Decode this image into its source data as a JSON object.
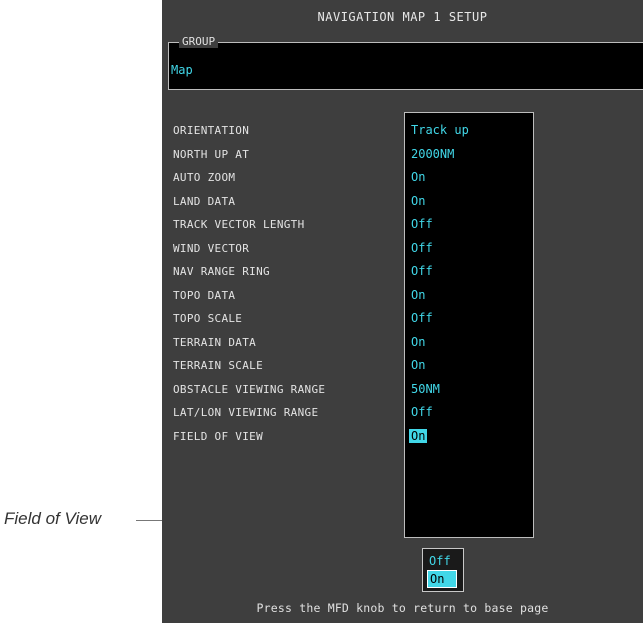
{
  "callout": {
    "text": "Field of View"
  },
  "screen": {
    "title": "NAVIGATION MAP 1 SETUP",
    "group": {
      "label": "GROUP",
      "value": "Map"
    },
    "rows": [
      {
        "label": "ORIENTATION",
        "value": "Track up"
      },
      {
        "label": "NORTH UP AT",
        "value": "2000NM"
      },
      {
        "label": "AUTO ZOOM",
        "value": "On"
      },
      {
        "label": "LAND DATA",
        "value": "On"
      },
      {
        "label": "TRACK VECTOR LENGTH",
        "value": "Off"
      },
      {
        "label": "WIND VECTOR",
        "value": "Off"
      },
      {
        "label": "NAV RANGE RING",
        "value": "Off"
      },
      {
        "label": "TOPO DATA",
        "value": "On"
      },
      {
        "label": "TOPO SCALE",
        "value": "Off"
      },
      {
        "label": "TERRAIN DATA",
        "value": "On"
      },
      {
        "label": "TERRAIN SCALE",
        "value": "On"
      },
      {
        "label": "OBSTACLE VIEWING RANGE",
        "value": "50NM"
      },
      {
        "label": "LAT/LON VIEWING RANGE",
        "value": "Off"
      },
      {
        "label": "FIELD OF VIEW",
        "value": "On"
      }
    ],
    "popup": {
      "options": [
        "Off",
        "On"
      ],
      "selected": "On"
    },
    "footer": "Press the MFD knob to return to base page"
  },
  "colors": {
    "background": "#3e3e3e",
    "value_text": "#41d7e8",
    "label_text": "#e3e3e3",
    "field_bg": "#000000"
  }
}
